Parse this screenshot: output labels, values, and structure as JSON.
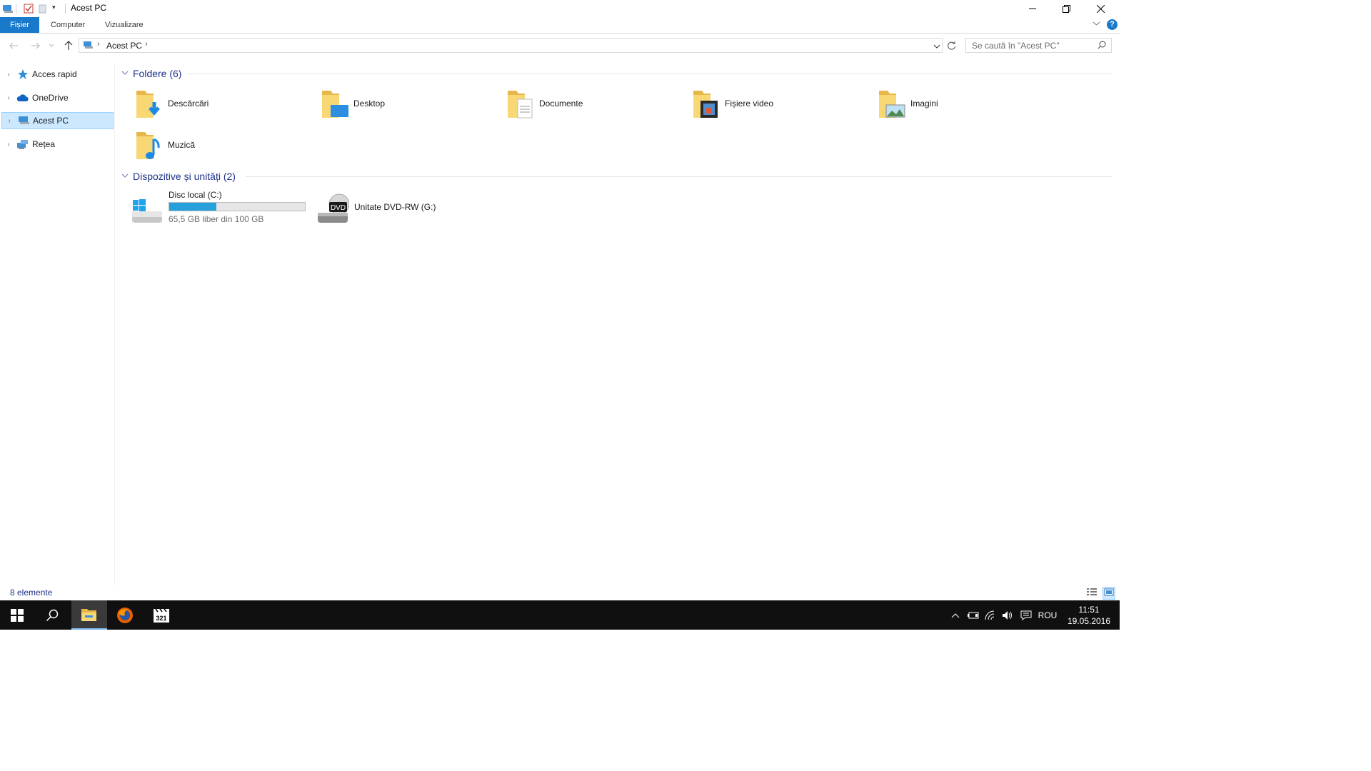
{
  "window": {
    "title": "Acest PC"
  },
  "ribbon": {
    "tabs": [
      "Fișier",
      "Computer",
      "Vizualizare"
    ]
  },
  "address": {
    "crumbs": [
      "Acest PC"
    ]
  },
  "search": {
    "placeholder": "Se caută în \"Acest PC\""
  },
  "navpane": {
    "items": [
      {
        "label": "Acces rapid",
        "icon": "star-icon"
      },
      {
        "label": "OneDrive",
        "icon": "cloud-icon"
      },
      {
        "label": "Acest PC",
        "icon": "computer-icon",
        "selected": true
      },
      {
        "label": "Rețea",
        "icon": "network-icon"
      }
    ]
  },
  "groups": {
    "folders": {
      "title": "Foldere (6)",
      "items": [
        {
          "label": "Descărcări",
          "icon": "downloads-folder-icon"
        },
        {
          "label": "Desktop",
          "icon": "desktop-folder-icon"
        },
        {
          "label": "Documente",
          "icon": "documents-folder-icon"
        },
        {
          "label": "Fișiere video",
          "icon": "videos-folder-icon"
        },
        {
          "label": "Imagini",
          "icon": "pictures-folder-icon"
        },
        {
          "label": "Muzică",
          "icon": "music-folder-icon"
        }
      ]
    },
    "devices": {
      "title": "Dispozitive și unități (2)",
      "items": [
        {
          "label": "Disc local (C:)",
          "detail": "65,5 GB liber din 100 GB",
          "used_fraction": 0.345,
          "icon": "windows-drive-icon"
        },
        {
          "label": "Unitate DVD-RW (G:)",
          "icon": "dvd-drive-icon",
          "badge": "DVD"
        }
      ]
    }
  },
  "status": {
    "text": "8 elemente"
  },
  "taskbar": {
    "language": "ROU",
    "time": "11:51",
    "date": "19.05.2016",
    "app_badge": "321"
  },
  "colors": {
    "accent": "#1979ca",
    "selection": "#cce8ff",
    "bar_fill": "#26a0da",
    "group_title": "#1e3287"
  }
}
